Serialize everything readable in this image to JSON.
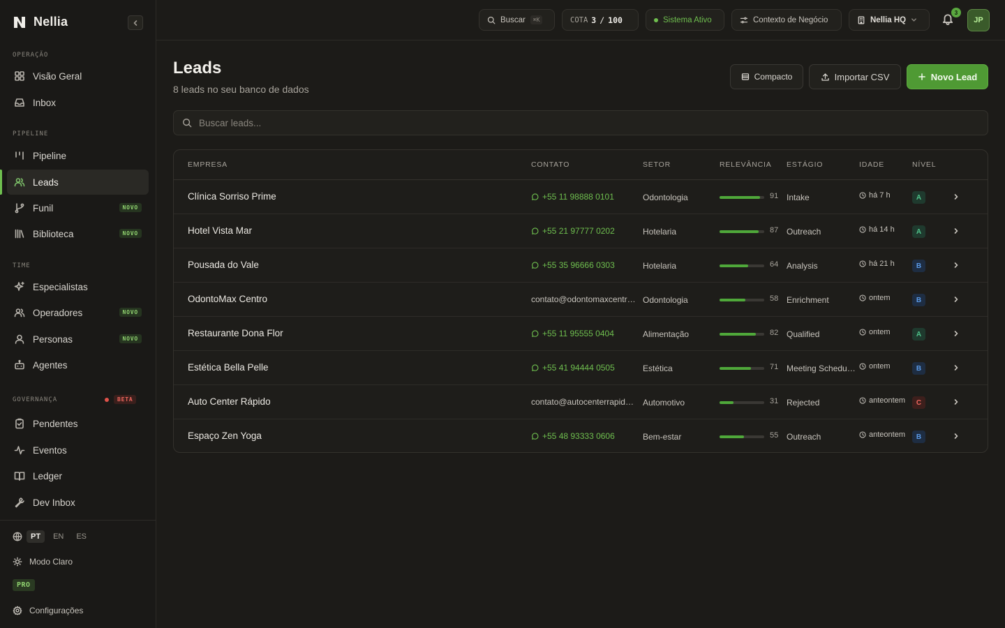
{
  "brand": {
    "name": "Nellia"
  },
  "sidebar": {
    "sections": {
      "operacao": "OPERAÇÃO",
      "pipeline": "PIPELINE",
      "time": "TIME",
      "governanca": "GOVERNANÇA"
    },
    "items": {
      "visao_geral": "Visão Geral",
      "inbox": "Inbox",
      "pipeline": "Pipeline",
      "leads": "Leads",
      "funil": "Funil",
      "biblioteca": "Biblioteca",
      "especialistas": "Especialistas",
      "operadores": "Operadores",
      "personas": "Personas",
      "agentes": "Agentes",
      "pendentes": "Pendentes",
      "eventos": "Eventos",
      "ledger": "Ledger",
      "dev_inbox": "Dev Inbox"
    },
    "badges": {
      "novo": "NOVO",
      "beta": "BETA"
    },
    "languages": [
      "PT",
      "EN",
      "ES"
    ],
    "active_language": "PT",
    "theme_label": "Modo Claro",
    "plan": "PRO",
    "settings_label": "Configurações"
  },
  "topbar": {
    "search_label": "Buscar",
    "search_shortcut": "⌘K",
    "quota_label": "COTA",
    "quota_used": "3",
    "quota_sep": "/",
    "quota_total": "100",
    "status_label": "Sistema Ativo",
    "context_label": "Contexto de Negócio",
    "workspace_label": "Nellia HQ",
    "notifications_count": "3",
    "user_initials": "JP"
  },
  "page": {
    "title": "Leads",
    "subtitle": "8 leads no seu banco de dados",
    "compact_label": "Compacto",
    "import_label": "Importar CSV",
    "new_lead_label": "Novo Lead",
    "search_placeholder": "Buscar leads..."
  },
  "table": {
    "columns": {
      "empresa": "EMPRESA",
      "contato": "CONTATO",
      "setor": "SETOR",
      "relevancia": "RELEVÂNCIA",
      "estagio": "ESTÁGIO",
      "idade": "IDADE",
      "nivel": "NÍVEL"
    },
    "rows": [
      {
        "company": "Clínica Sorriso Prime",
        "contact": "+55 11 98888 0101",
        "contact_type": "whatsapp",
        "sector": "Odontologia",
        "relevance": 91,
        "stage": "Intake",
        "age": "há 7 h",
        "tier": "A"
      },
      {
        "company": "Hotel Vista Mar",
        "contact": "+55 21 97777 0202",
        "contact_type": "whatsapp",
        "sector": "Hotelaria",
        "relevance": 87,
        "stage": "Outreach",
        "age": "há 14 h",
        "tier": "A"
      },
      {
        "company": "Pousada do Vale",
        "contact": "+55 35 96666 0303",
        "contact_type": "whatsapp",
        "sector": "Hotelaria",
        "relevance": 64,
        "stage": "Analysis",
        "age": "há 21 h",
        "tier": "B"
      },
      {
        "company": "OdontoMax Centro",
        "contact": "contato@odontomaxcentro.com.br",
        "contact_type": "email",
        "sector": "Odontologia",
        "relevance": 58,
        "stage": "Enrichment",
        "age": "ontem",
        "tier": "B"
      },
      {
        "company": "Restaurante Dona Flor",
        "contact": "+55 11 95555 0404",
        "contact_type": "whatsapp",
        "sector": "Alimentação",
        "relevance": 82,
        "stage": "Qualified",
        "age": "ontem",
        "tier": "A"
      },
      {
        "company": "Estética Bella Pelle",
        "contact": "+55 41 94444 0505",
        "contact_type": "whatsapp",
        "sector": "Estética",
        "relevance": 71,
        "stage": "Meeting Scheduled",
        "age": "ontem",
        "tier": "B"
      },
      {
        "company": "Auto Center Rápido",
        "contact": "contato@autocenterrapido.com.br",
        "contact_type": "email",
        "sector": "Automotivo",
        "relevance": 31,
        "stage": "Rejected",
        "age": "anteontem",
        "tier": "C"
      },
      {
        "company": "Espaço Zen Yoga",
        "contact": "+55 48 93333 0606",
        "contact_type": "whatsapp",
        "sector": "Bem-estar",
        "relevance": 55,
        "stage": "Outreach",
        "age": "anteontem",
        "tier": "B"
      }
    ]
  },
  "colors": {
    "accent": "#4f9a34",
    "tier_a": "#4fc28a",
    "tier_b": "#5b9be8",
    "tier_c": "#f0675e"
  }
}
